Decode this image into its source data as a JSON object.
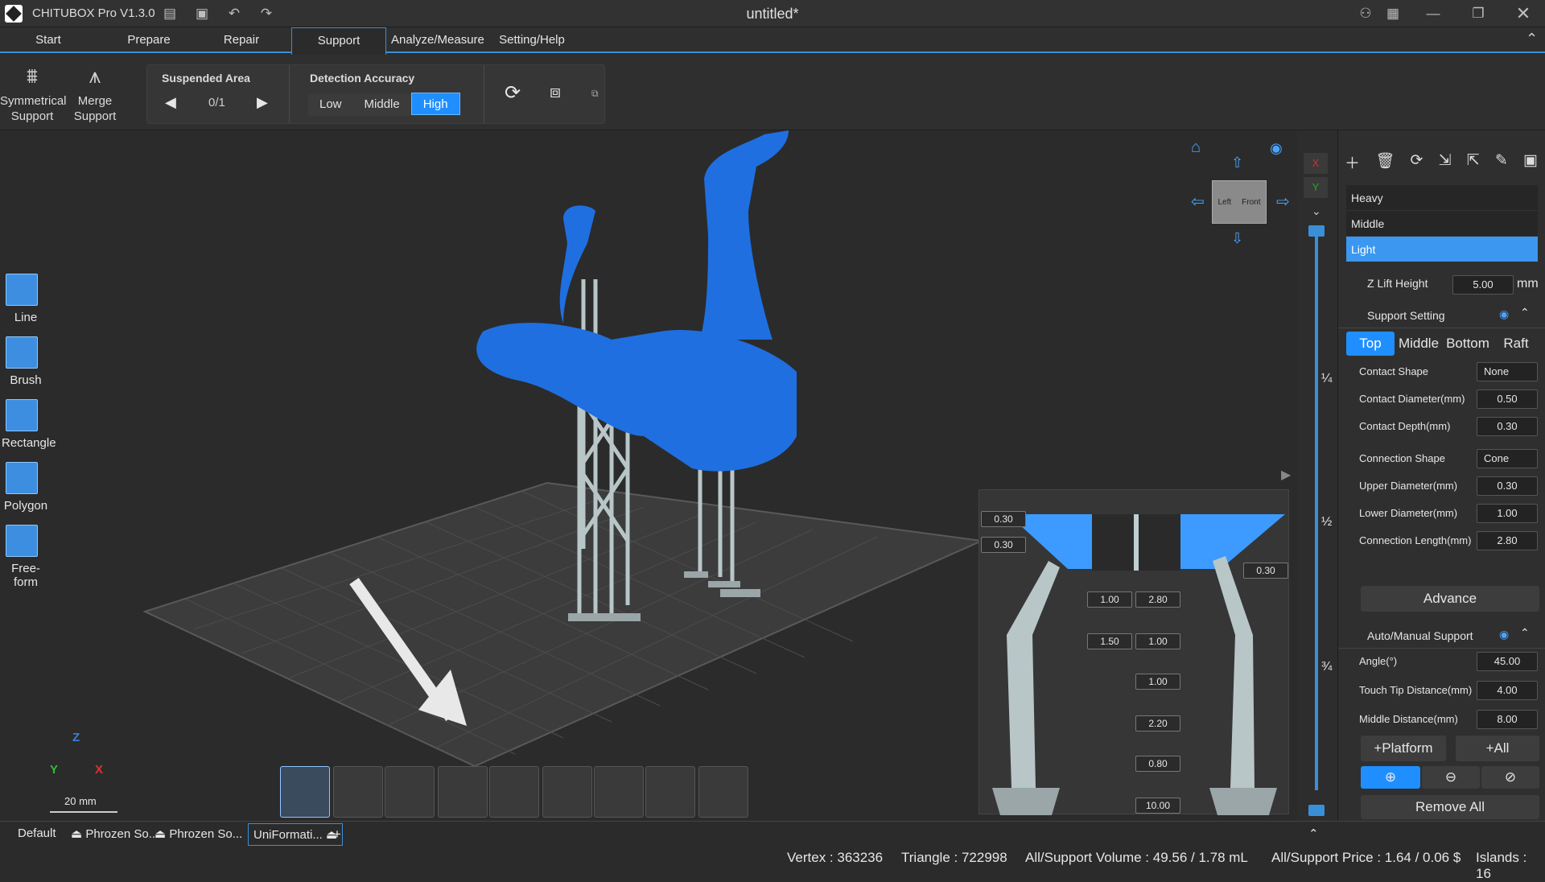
{
  "app": {
    "name": "CHITUBOX Pro V1.3.0",
    "doc_title": "untitled*"
  },
  "menu": {
    "tabs": [
      "Start",
      "Prepare",
      "Repair",
      "Support",
      "Analyze/Measure",
      "Setting/Help"
    ],
    "active": "Support"
  },
  "ribbon": {
    "symmetrical_support": "Symmetrical\nSupport",
    "merge_support": "Merge\nSupport",
    "suspended_area_label": "Suspended Area",
    "suspended_area_counter": "0/1",
    "detection_accuracy_label": "Detection Accuracy",
    "accuracy_options": [
      "Low",
      "Middle",
      "High"
    ],
    "accuracy_selected": "High"
  },
  "left_tools": [
    "Line",
    "Brush",
    "Rectangle",
    "Polygon",
    "Free-form"
  ],
  "scale": {
    "label": "20 mm",
    "axes": [
      "Z",
      "Y",
      "X"
    ]
  },
  "view_cube": {
    "left": "Left",
    "front": "Front"
  },
  "right_strip": {
    "fractions": [
      "¼",
      "½",
      "¾"
    ]
  },
  "panel": {
    "presets": [
      "Heavy",
      "Middle",
      "Light"
    ],
    "preset_selected": "Light",
    "z_lift_label": "Z Lift Height",
    "z_lift_value": "5.00",
    "z_lift_unit": "mm",
    "support_setting_label": "Support Setting",
    "part_tabs": [
      "Top",
      "Middle",
      "Bottom",
      "Raft"
    ],
    "part_selected": "Top",
    "fields": [
      {
        "label": "Contact Shape",
        "value": "None",
        "type": "select"
      },
      {
        "label": "Contact Diameter(mm)",
        "value": "0.50",
        "type": "spin"
      },
      {
        "label": "Contact Depth(mm)",
        "value": "0.30",
        "type": "spin"
      },
      {
        "label": "Connection Shape",
        "value": "Cone",
        "type": "select"
      },
      {
        "label": "Upper Diameter(mm)",
        "value": "0.30",
        "type": "spin"
      },
      {
        "label": "Lower Diameter(mm)",
        "value": "1.00",
        "type": "spin"
      },
      {
        "label": "Connection Length(mm)",
        "value": "2.80",
        "type": "spin"
      }
    ],
    "advance_button": "Advance",
    "auto_manual_label": "Auto/Manual Support",
    "auto_fields": [
      {
        "label": "Angle(°)",
        "value": "45.00"
      },
      {
        "label": "Touch Tip Distance(mm)",
        "value": "4.00"
      },
      {
        "label": "Middle Distance(mm)",
        "value": "8.00"
      }
    ],
    "platform_button": "+Platform",
    "all_button": "+All",
    "remove_all_button": "Remove All"
  },
  "detail_values": [
    "0.30",
    "0.30",
    "0.30",
    "1.00",
    "2.80",
    "1.50",
    "1.00",
    "1.00",
    "2.20",
    "0.80",
    "10.00"
  ],
  "bottom_tabs": [
    "Default",
    "Phrozen So...",
    "Phrozen So...",
    "UniFormati..."
  ],
  "status": {
    "vertex": "Vertex : 363236",
    "triangle": "Triangle : 722998",
    "volume": "All/Support Volume : 49.56 / 1.78 mL",
    "price": "All/Support Price : 1.64 / 0.06 $",
    "islands": "Islands : 16"
  },
  "colors": {
    "accent": "#1f8fff",
    "model": "#1f6fe0",
    "support": "#b8c6c8"
  }
}
